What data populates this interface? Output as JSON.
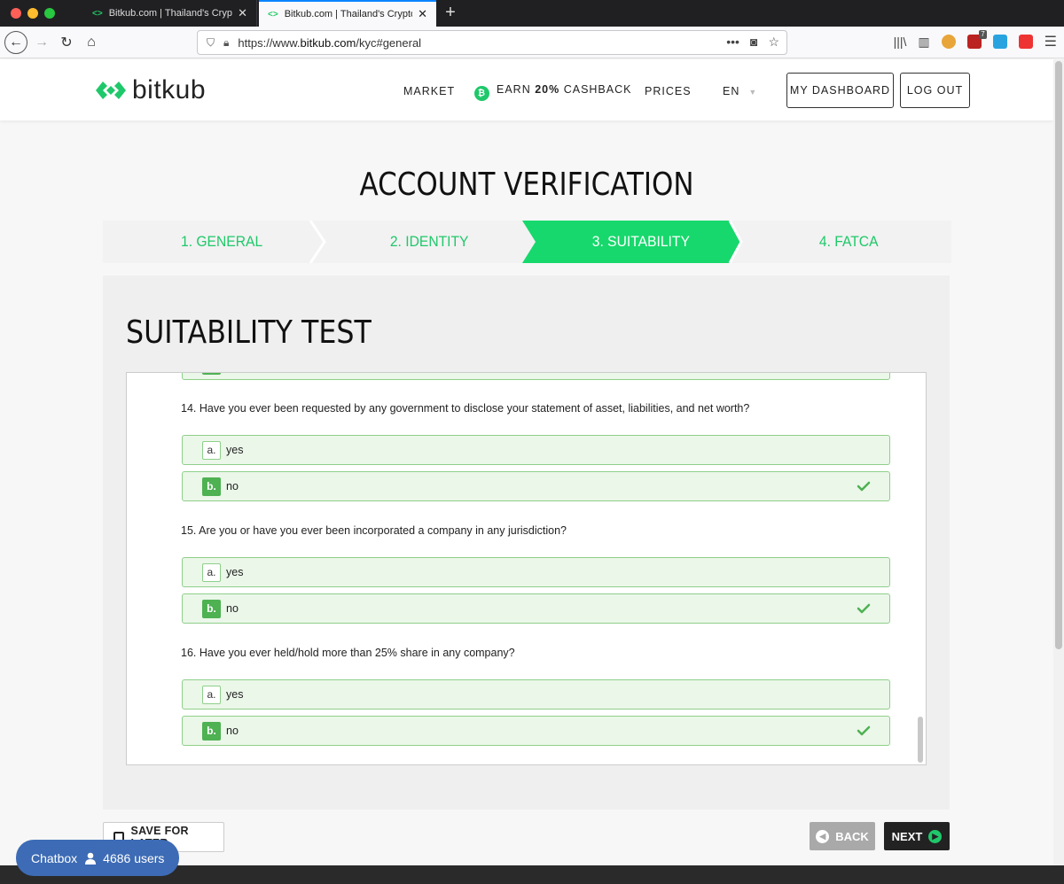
{
  "browser": {
    "tabs": [
      {
        "title": "Bitkub.com | Thailand's Cryptocurrency Exchange",
        "active": false
      },
      {
        "title": "Bitkub.com | Thailand's Cryptocurrency Exchange",
        "active": true
      }
    ],
    "url_scheme": "https://www.",
    "url_host": "bitkub.com",
    "url_path": "/kyc#general",
    "ext_badge": "7"
  },
  "header": {
    "logo_text": "bitkub",
    "menu": {
      "market": "MARKET",
      "earn_prefix": "EARN ",
      "earn_bold": "20%",
      "earn_suffix": " CASHBACK",
      "prices": "PRICES",
      "lang": "EN"
    },
    "dashboard_label": "MY DASHBOARD",
    "logout_label": "LOG OUT"
  },
  "page": {
    "title": "ACCOUNT VERIFICATION",
    "steps": [
      "1. GENERAL",
      "2. IDENTITY",
      "3. SUITABILITY",
      "4. FATCA"
    ],
    "active_step": 2,
    "section_title": "SUITABILITY TEST"
  },
  "questions": [
    {
      "text": "14. Have you ever been requested by any government to disclose your statement of asset, liabilities, and net worth?",
      "options": [
        {
          "letter": "a.",
          "text": "yes",
          "selected": false
        },
        {
          "letter": "b.",
          "text": "no",
          "selected": true
        }
      ]
    },
    {
      "text": "15. Are you or have you ever been incorporated a company in any jurisdiction?",
      "options": [
        {
          "letter": "a.",
          "text": "yes",
          "selected": false
        },
        {
          "letter": "b.",
          "text": "no",
          "selected": true
        }
      ]
    },
    {
      "text": "16. Have you ever held/hold more than 25% share in any company?",
      "options": [
        {
          "letter": "a.",
          "text": "yes",
          "selected": false
        },
        {
          "letter": "b.",
          "text": "no",
          "selected": true
        }
      ]
    }
  ],
  "actions": {
    "save_label": "SAVE FOR LATER",
    "back_label": "BACK",
    "next_label": "NEXT"
  },
  "chatbox": {
    "label": "Chatbox",
    "users": "4686 users"
  },
  "colors": {
    "brand_green": "#1fc86a",
    "selected_green": "#4eb152",
    "option_bg": "#ebf7e9",
    "chat_blue": "#3d6bb5"
  }
}
